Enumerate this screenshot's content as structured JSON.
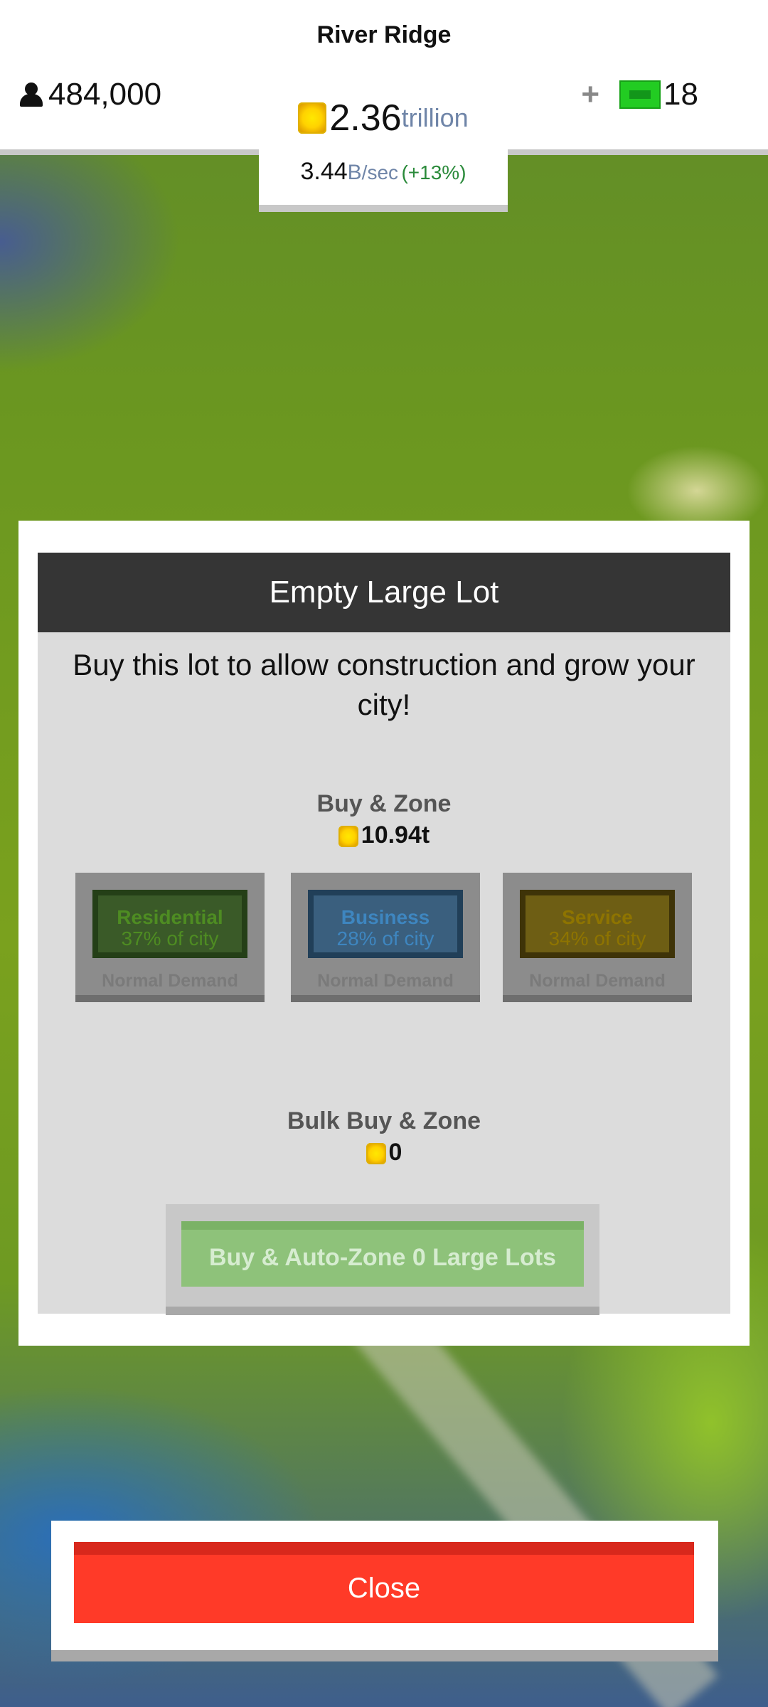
{
  "header": {
    "city_name": "River Ridge",
    "population": "484,000",
    "cash_amount": "2.36",
    "cash_unit": "trillion",
    "rate_amount": "3.44",
    "rate_unit": "B",
    "rate_per": "/sec",
    "rate_change": "(+13%)",
    "bucks_plus": "+",
    "bucks_count": "18"
  },
  "dialog": {
    "title": "Empty Large Lot",
    "description": "Buy this lot to allow construction and grow your city!",
    "buy_zone_label": "Buy & Zone",
    "buy_zone_price": "10.94t",
    "zones": [
      {
        "name": "Residential",
        "share": "37% of city",
        "demand": "Normal Demand",
        "color": "#4e8c22"
      },
      {
        "name": "Business",
        "share": "28% of city",
        "demand": "Normal Demand",
        "color": "#3e86c0"
      },
      {
        "name": "Service",
        "share": "34% of city",
        "demand": "Normal Demand",
        "color": "#8e7400"
      }
    ],
    "bulk_label": "Bulk Buy & Zone",
    "bulk_price": "0",
    "bulk_button_label": "Buy & Auto-Zone 0 Large Lots"
  },
  "footer": {
    "close_label": "Close",
    "close_color": "#ff3a28"
  },
  "icons": {
    "population": "person-icon",
    "cash": "coin-icon",
    "bucks": "cash-bill-icon",
    "add": "plus-icon"
  }
}
